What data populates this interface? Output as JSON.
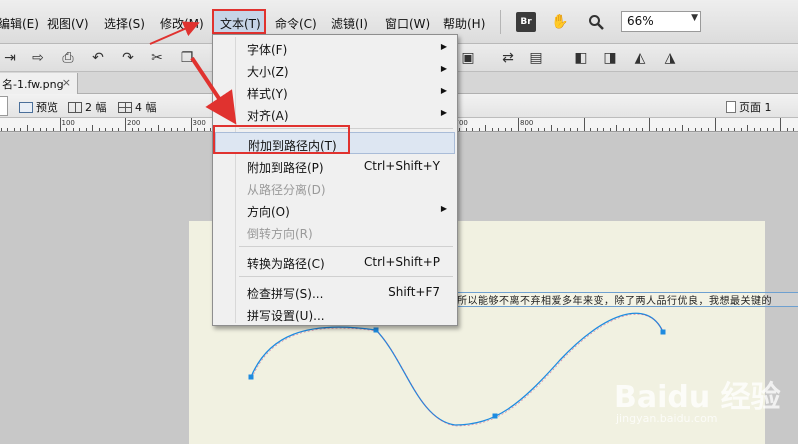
{
  "menubar": {
    "items": [
      {
        "label": "编辑(E)"
      },
      {
        "label": "视图(V)"
      },
      {
        "label": "选择(S)"
      },
      {
        "label": "修改(M)"
      },
      {
        "label": "文本(T)"
      },
      {
        "label": "命令(C)"
      },
      {
        "label": "滤镜(I)"
      },
      {
        "label": "窗口(W)"
      },
      {
        "label": "帮助(H)"
      }
    ],
    "br_label": "Br",
    "zoom_value": "66%"
  },
  "doc_tab": {
    "title": "名-1.fw.png",
    "close": "×"
  },
  "viewbar": {
    "preview": "预览",
    "two_up": "2 幅",
    "four_up": "4 幅",
    "page": "页面 1"
  },
  "ruler": {
    "labels": [
      "100",
      "200",
      "300",
      "400",
      "500",
      "600",
      "700",
      "800"
    ]
  },
  "menu": {
    "items": [
      {
        "label": "字体(F)",
        "submenu": true
      },
      {
        "label": "大小(Z)",
        "submenu": true
      },
      {
        "label": "样式(Y)",
        "submenu": true
      },
      {
        "label": "对齐(A)",
        "submenu": true
      },
      {
        "label": "附加到路径内(T)",
        "highlighted": true
      },
      {
        "label": "附加到路径(P)",
        "shortcut": "Ctrl+Shift+Y"
      },
      {
        "label": "从路径分离(D)",
        "disabled": true
      },
      {
        "label": "方向(O)",
        "submenu": true
      },
      {
        "label": "倒转方向(R)",
        "disabled": true
      },
      {
        "label": "转换为路径(C)",
        "shortcut": "Ctrl+Shift+P"
      },
      {
        "label": "检查拼写(S)...",
        "shortcut": "Shift+F7"
      },
      {
        "label": "拼写设置(U)..."
      }
    ]
  },
  "canvas": {
    "path_text": "所以能够不离不弃相爱多年来变，除了两人品行优良，我想最关键的"
  },
  "watermark": {
    "main": "Baidu 经验",
    "sub": "jingyan.baidu.com"
  },
  "colors": {
    "menu_highlight": "#c6d4e7",
    "annotation_red": "#e0322f",
    "path_blue": "#1e8be0",
    "document_bg": "#f1f1e1"
  }
}
